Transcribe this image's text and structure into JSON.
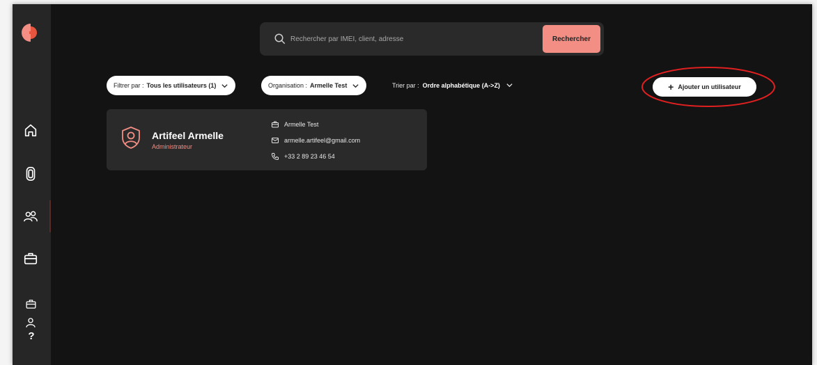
{
  "colors": {
    "accent": "#f28e84",
    "background": "#131313",
    "sidebar": "#262626",
    "card": "#2a2a2a",
    "annotation": "#e02020"
  },
  "search": {
    "placeholder": "Rechercher par IMEI, client, adresse",
    "button_label": "Rechercher"
  },
  "filters": {
    "filter": {
      "label": "Filtrer par :",
      "value": "Tous les utilisateurs (1)"
    },
    "organisation": {
      "label": "Organisation :",
      "value": "Armelle Test"
    },
    "sort": {
      "label": "Trier par :",
      "value": "Ordre alphabétique (A->Z)"
    }
  },
  "add_user": {
    "label": "Ajouter un utilisateur",
    "icon": "plus-icon"
  },
  "sidebar": {
    "items": [
      {
        "icon": "home-icon"
      },
      {
        "icon": "device-icon"
      },
      {
        "icon": "users-icon",
        "active": true
      },
      {
        "icon": "briefcase-icon"
      },
      {
        "icon": "briefcase-small-icon"
      },
      {
        "icon": "user-icon"
      }
    ],
    "help_label": "?"
  },
  "users": [
    {
      "name": "Artifeel Armelle",
      "role": "Administrateur",
      "organisation": "Armelle Test",
      "email": "armelle.artifeel@gmail.com",
      "phone": "+33 2 89 23 46 54"
    }
  ]
}
